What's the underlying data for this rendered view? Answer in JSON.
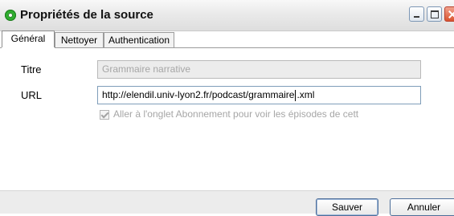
{
  "window": {
    "title": "Propriétés de la source",
    "icon": "green-circle-icon"
  },
  "tabs": [
    {
      "label": "Général",
      "active": true
    },
    {
      "label": "Nettoyer",
      "active": false
    },
    {
      "label": "Authentication",
      "active": false
    }
  ],
  "form": {
    "title_label": "Titre",
    "title_value": "Grammaire narrative",
    "url_label": "URL",
    "url_value_before_caret": "http://elendil.univ-lyon2.fr/podcast/grammaire",
    "url_value_after_caret": ".xml",
    "checkbox_label": "Aller à l'onglet Abonnement pour voir les épisodes de cett",
    "checkbox_checked": true
  },
  "buttons": {
    "save": "Sauver",
    "cancel": "Annuler"
  }
}
